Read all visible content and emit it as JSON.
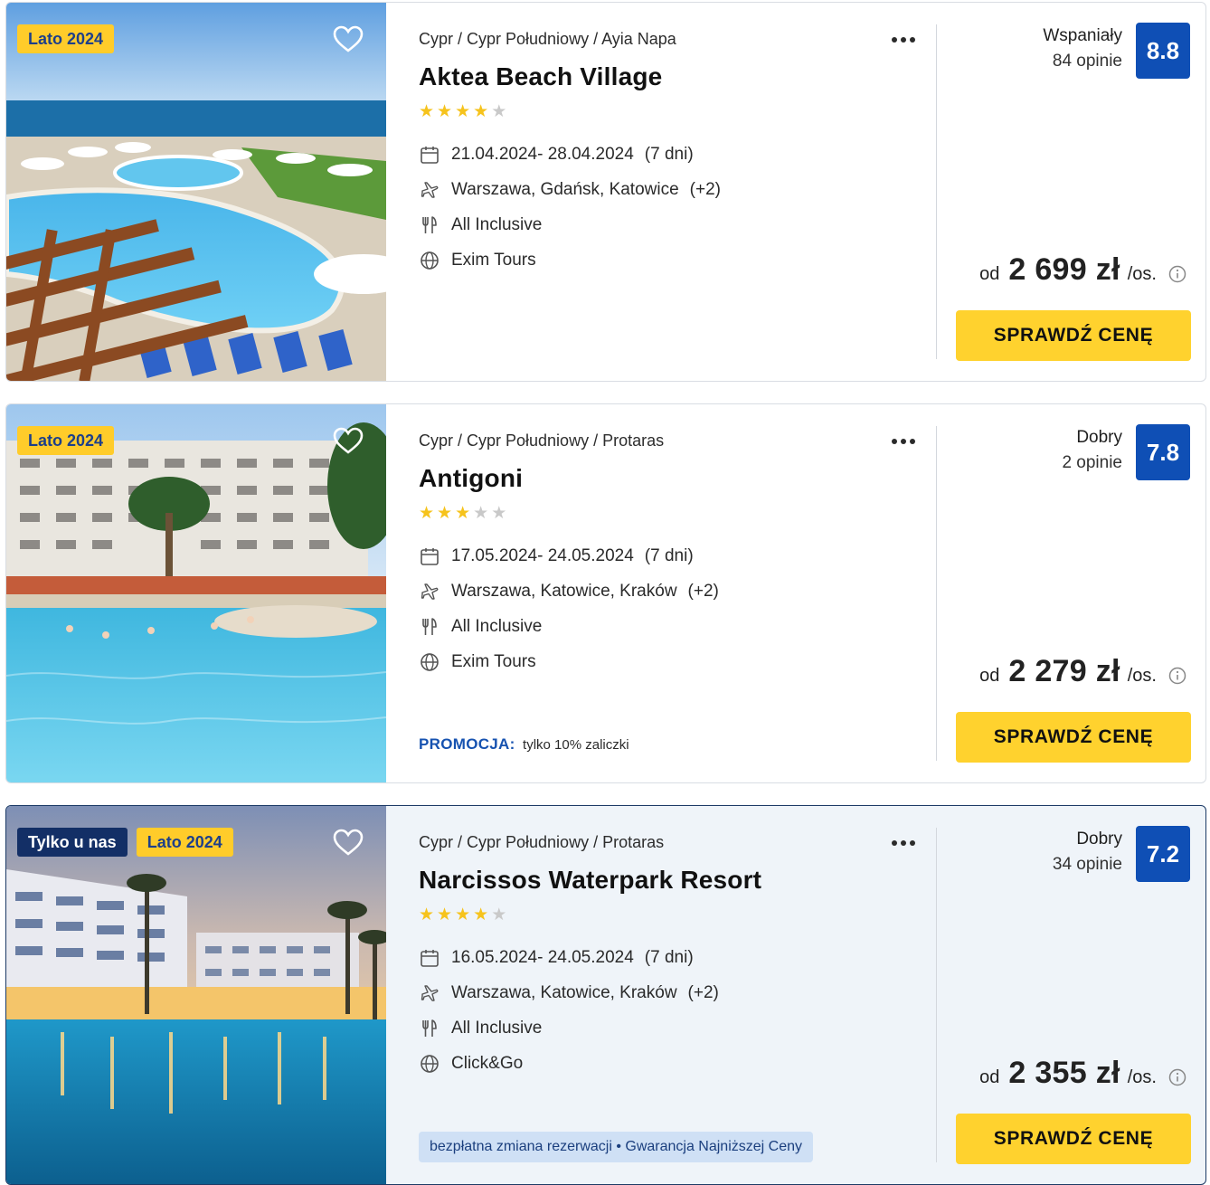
{
  "colors": {
    "accent_blue": "#0f4fb5",
    "cta_yellow": "#ffd22e",
    "season_badge": "#ffcc2a",
    "exclusive_badge": "#132f66",
    "star_on": "#f6c31c",
    "star_off": "#c9c9c9"
  },
  "offers": [
    {
      "badges": [
        "Lato 2024"
      ],
      "breadcrumb": "Cypr / Cypr Południowy / Ayia Napa",
      "name": "Aktea Beach Village",
      "stars": 4,
      "dates": "21.04.2024- 28.04.2024",
      "duration": "(7 dni)",
      "departures": "Warszawa, Gdańsk, Katowice",
      "departures_more": "(+2)",
      "board": "All Inclusive",
      "operator": "Exim Tours",
      "rating_word": "Wspaniały",
      "rating_count": "84 opinie",
      "rating_score": "8.8",
      "price_prefix": "od",
      "price": "2 699 zł",
      "price_unit": "/os.",
      "cta": "SPRAWDŹ CENĘ"
    },
    {
      "badges": [
        "Lato 2024"
      ],
      "breadcrumb": "Cypr / Cypr Południowy / Protaras",
      "name": "Antigoni",
      "stars": 3,
      "dates": "17.05.2024- 24.05.2024",
      "duration": "(7 dni)",
      "departures": "Warszawa, Katowice, Kraków",
      "departures_more": "(+2)",
      "board": "All Inclusive",
      "operator": "Exim Tours",
      "promo_label": "PROMOCJA:",
      "promo_text": "tylko 10% zaliczki",
      "rating_word": "Dobry",
      "rating_count": "2 opinie",
      "rating_score": "7.8",
      "price_prefix": "od",
      "price": "2 279 zł",
      "price_unit": "/os.",
      "cta": "SPRAWDŹ CENĘ"
    },
    {
      "badges": [
        "Tylko u nas",
        "Lato 2024"
      ],
      "breadcrumb": "Cypr / Cypr Południowy / Protaras",
      "name": "Narcissos Waterpark Resort",
      "stars": 4,
      "dates": "16.05.2024- 24.05.2024",
      "duration": "(7 dni)",
      "departures": "Warszawa, Katowice, Kraków",
      "departures_more": "(+2)",
      "board": "All Inclusive",
      "operator": "Click&Go",
      "benefits": "bezpłatna zmiana rezerwacji • Gwarancja Najniższej Ceny",
      "rating_word": "Dobry",
      "rating_count": "34 opinie",
      "rating_score": "7.2",
      "price_prefix": "od",
      "price": "2 355 zł",
      "price_unit": "/os.",
      "cta": "SPRAWDŹ CENĘ"
    }
  ]
}
